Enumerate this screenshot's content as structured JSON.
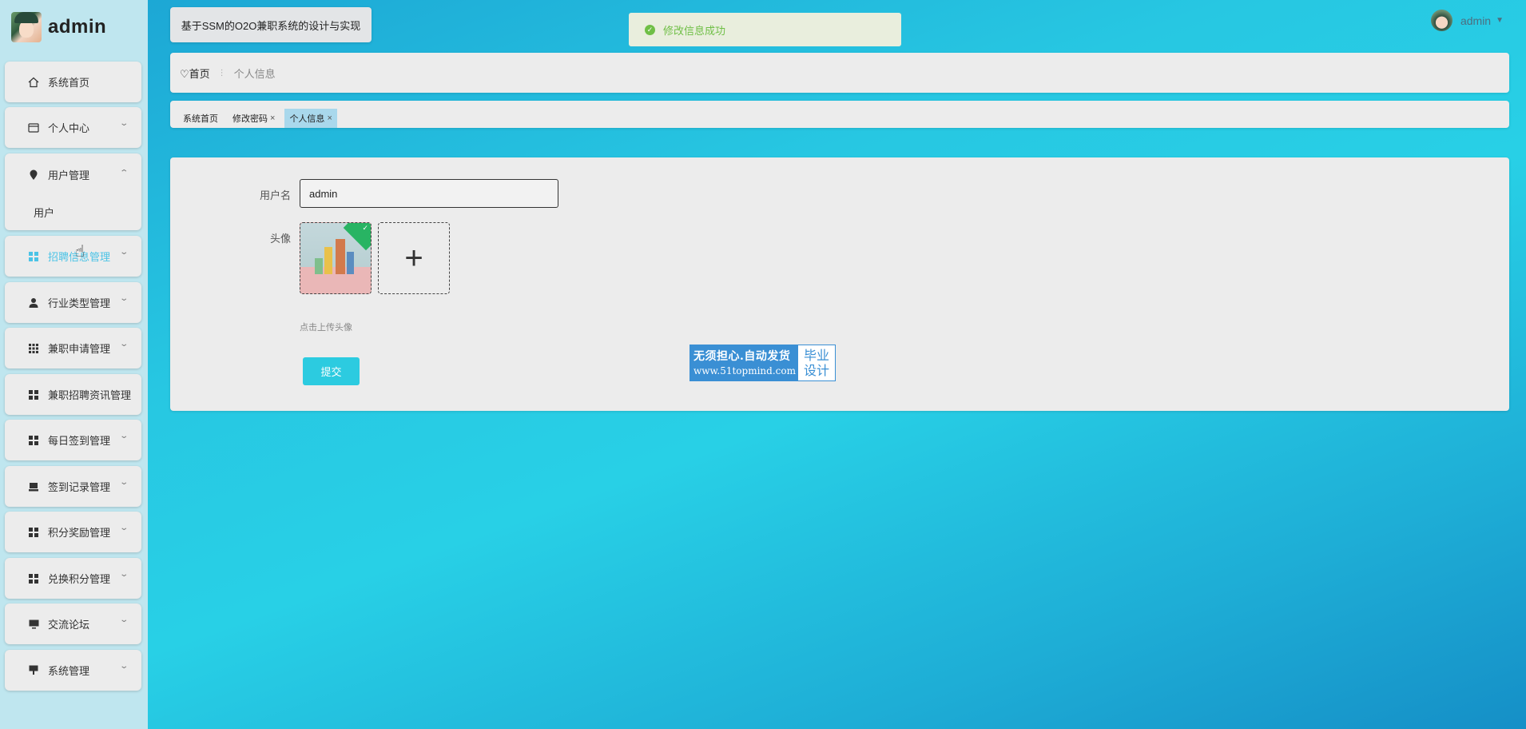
{
  "brand": {
    "title": "admin"
  },
  "sidebar": {
    "items": [
      {
        "label": "系统首页",
        "icon": "home-icon"
      },
      {
        "label": "个人中心",
        "icon": "card-icon"
      },
      {
        "label": "用户管理",
        "icon": "pin-icon",
        "sub": "用户"
      },
      {
        "label": "招聘信息管理",
        "icon": "grid-icon"
      },
      {
        "label": "行业类型管理",
        "icon": "person-icon"
      },
      {
        "label": "兼职申请管理",
        "icon": "dots-grid-icon"
      },
      {
        "label": "兼职招聘资讯管理",
        "icon": "grid-icon"
      },
      {
        "label": "每日签到管理",
        "icon": "grid-icon"
      },
      {
        "label": "签到记录管理",
        "icon": "tray-icon"
      },
      {
        "label": "积分奖励管理",
        "icon": "grid-icon"
      },
      {
        "label": "兑换积分管理",
        "icon": "grid-icon"
      },
      {
        "label": "交流论坛",
        "icon": "monitor-icon"
      },
      {
        "label": "系统管理",
        "icon": "sign-icon"
      }
    ]
  },
  "header": {
    "site_title": "基于SSM的O2O兼职系统的设计与实现",
    "toast": "修改信息成功",
    "user": "admin"
  },
  "breadcrumb": {
    "home": "首页",
    "current": "个人信息"
  },
  "tabs": [
    {
      "label": "系统首页",
      "closable": false
    },
    {
      "label": "修改密码",
      "closable": true
    },
    {
      "label": "个人信息",
      "closable": true,
      "active": true
    }
  ],
  "form": {
    "username_label": "用户名",
    "username_value": "admin",
    "avatar_label": "头像",
    "upload_hint": "点击上传头像",
    "submit_label": "提交"
  },
  "watermark": {
    "line1": "无须担心.自动发货",
    "line2": "www.51topmind.com",
    "right1": "毕业",
    "right2": "设计"
  },
  "colors": {
    "accent": "#2ccbe0",
    "toast_green": "#6fbf46",
    "sidebar_bg": "#bfe6ef"
  }
}
